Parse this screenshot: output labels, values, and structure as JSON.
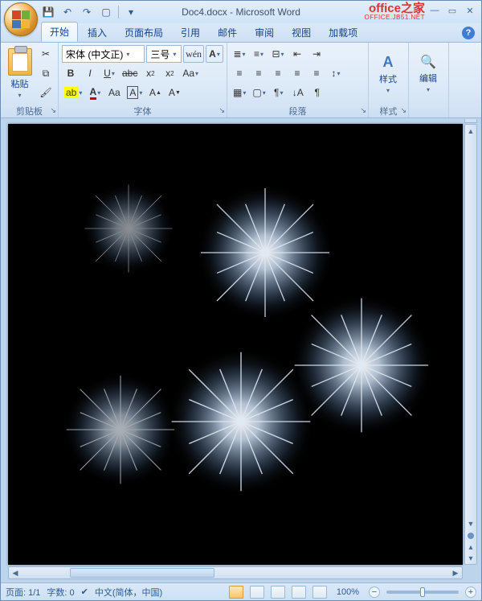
{
  "title": "Doc4.docx - Microsoft Word",
  "watermark": {
    "main": "office之家",
    "sub": "OFFICE.JB51.NET"
  },
  "qat": {
    "save": "save",
    "undo": "undo",
    "redo": "redo",
    "new": "new"
  },
  "tabs": [
    {
      "id": "home",
      "label": "开始",
      "active": true
    },
    {
      "id": "insert",
      "label": "插入"
    },
    {
      "id": "layout",
      "label": "页面布局"
    },
    {
      "id": "references",
      "label": "引用"
    },
    {
      "id": "mailings",
      "label": "邮件"
    },
    {
      "id": "review",
      "label": "审阅"
    },
    {
      "id": "view",
      "label": "视图"
    },
    {
      "id": "addins",
      "label": "加载项"
    }
  ],
  "ribbon": {
    "clipboard": {
      "label": "剪贴板",
      "paste": "粘贴"
    },
    "font": {
      "label": "字体",
      "family": "宋体 (中文正)",
      "size": "三号"
    },
    "paragraph": {
      "label": "段落"
    },
    "styles": {
      "label": "样式",
      "btn": "样式"
    },
    "editing": {
      "label": "",
      "btn": "编辑"
    }
  },
  "status": {
    "page": "页面: 1/1",
    "words": "字数: 0",
    "lang": "中文(简体，中国)",
    "zoom": "100%"
  }
}
